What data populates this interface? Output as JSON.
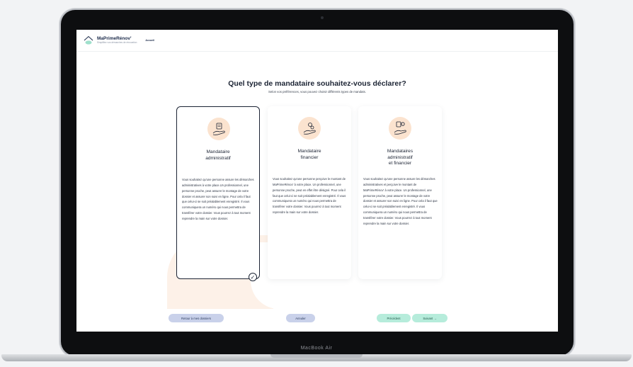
{
  "device": {
    "label": "MacBook Air"
  },
  "header": {
    "logo_name": "MaPrimeRénov'",
    "logo_tagline": "Simplifiez vos démarches de rénovation",
    "nav_home": "Accueil"
  },
  "page": {
    "title": "Quel type de mandataire souhaitez-vous déclarer?",
    "subtitle": "Selon vos préférences, vous pouvez choisir différents types de mandats."
  },
  "cards": [
    {
      "title_line1": "Mandataire",
      "title_line2": "administratif",
      "title_line3": "",
      "selected": true,
      "description": "Vous souhaitez qu'une personne assure les démarches administratives à votre place.Un professionnel, une personne proche, peut assurer le montage de votre dossier et assurer son suivi en ligne. Pour cela il faut que celui-ci se soit préalablement enregistré. Il vous communiquera un numéro qui nous permettra de transférer votre dossier. Vous pourrez à tout moment reprendre la main sur votre dossier.",
      "check_mark": "✓"
    },
    {
      "title_line1": "Mandataire",
      "title_line2": "financier",
      "title_line3": "",
      "selected": false,
      "description": "Vous souhaitez qu'une personne perçoive le montant de MaPrimeRénov' à votre place. Un professionnel, une personne proche, peut en effet être désigné. Pour cela il faut que celui-ci se soit préalablement enregistré. Il vous communiquera un numéro qui nous permettra de transférer votre dossier. Vous pourrez à tout moment reprendre la main sur votre dossier."
    },
    {
      "title_line1": "Mandataires",
      "title_line2": "administratif",
      "title_line3": "et financier",
      "selected": false,
      "description": "Vous souhaitez qu'une personne assure les démarches administratives et perçoive le montant de MaPrimeRénov' à votre place. Un professionnel, une personne proche, peut assurer le montage de votre dossier et assurer son suivi en ligne. Pour cela il faut que celui-ci se soit préalablement enregistré. Il vous communiquera un numéro qui nous permettra de transférer votre dossier. Vous pourrez à tout moment reprendre la main sur votre dossier."
    }
  ],
  "footer": {
    "back_label": "Retour à mes dossiers",
    "cancel_label": "Annuler",
    "prev_label": "Précédent",
    "next_label": "Suivant →"
  },
  "colors": {
    "accent_peach": "#fbe3cf",
    "button_blue": "#c9d1ea",
    "button_mint": "#b6ecdb",
    "text_dark": "#1c2434"
  }
}
